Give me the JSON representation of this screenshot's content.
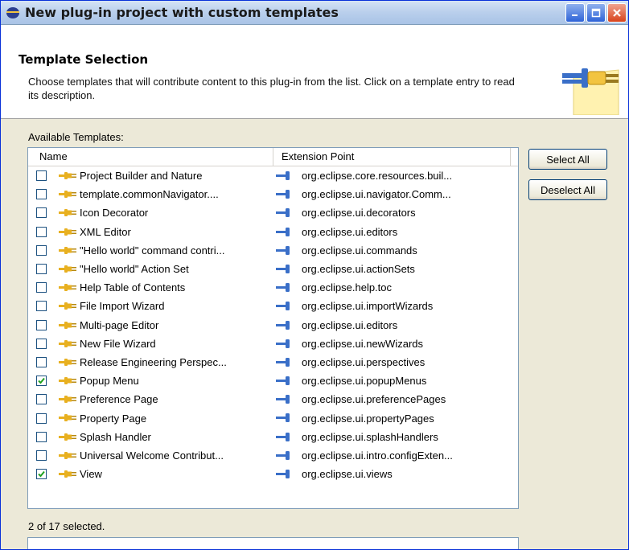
{
  "window": {
    "title": "New plug-in project with custom templates"
  },
  "header": {
    "title": "Template Selection",
    "description": "Choose templates that will contribute content to this plug-in from the list. Click on a template entry to read its description."
  },
  "templates_label": "Available Templates:",
  "table": {
    "columns": [
      "Name",
      "Extension Point"
    ],
    "rows": [
      {
        "name": "Project Builder and Nature",
        "ext": "org.eclipse.core.resources.buil...",
        "checked": false
      },
      {
        "name": "template.commonNavigator....",
        "ext": "org.eclipse.ui.navigator.Comm...",
        "checked": false
      },
      {
        "name": "Icon Decorator",
        "ext": "org.eclipse.ui.decorators",
        "checked": false
      },
      {
        "name": "XML Editor",
        "ext": "org.eclipse.ui.editors",
        "checked": false
      },
      {
        "name": "\"Hello world\" command contri...",
        "ext": "org.eclipse.ui.commands",
        "checked": false
      },
      {
        "name": "\"Hello world\" Action Set",
        "ext": "org.eclipse.ui.actionSets",
        "checked": false
      },
      {
        "name": "Help Table of Contents",
        "ext": "org.eclipse.help.toc",
        "checked": false
      },
      {
        "name": "File Import Wizard",
        "ext": "org.eclipse.ui.importWizards",
        "checked": false
      },
      {
        "name": "Multi-page Editor",
        "ext": "org.eclipse.ui.editors",
        "checked": false
      },
      {
        "name": "New File Wizard",
        "ext": "org.eclipse.ui.newWizards",
        "checked": false
      },
      {
        "name": "Release Engineering Perspec...",
        "ext": "org.eclipse.ui.perspectives",
        "checked": false
      },
      {
        "name": "Popup Menu",
        "ext": "org.eclipse.ui.popupMenus",
        "checked": true
      },
      {
        "name": "Preference Page",
        "ext": "org.eclipse.ui.preferencePages",
        "checked": false
      },
      {
        "name": "Property Page",
        "ext": "org.eclipse.ui.propertyPages",
        "checked": false
      },
      {
        "name": "Splash Handler",
        "ext": "org.eclipse.ui.splashHandlers",
        "checked": false
      },
      {
        "name": "Universal Welcome Contribut...",
        "ext": "org.eclipse.ui.intro.configExten...",
        "checked": false
      },
      {
        "name": "View",
        "ext": "org.eclipse.ui.views",
        "checked": true
      }
    ]
  },
  "buttons": {
    "select_all": "Select All",
    "deselect_all": "Deselect All"
  },
  "status": "2 of 17 selected.",
  "colors": {
    "accent": "#0831d9",
    "plug": "#e8b020",
    "ext_icon": "#3a6fc8",
    "check": "#21a121"
  }
}
